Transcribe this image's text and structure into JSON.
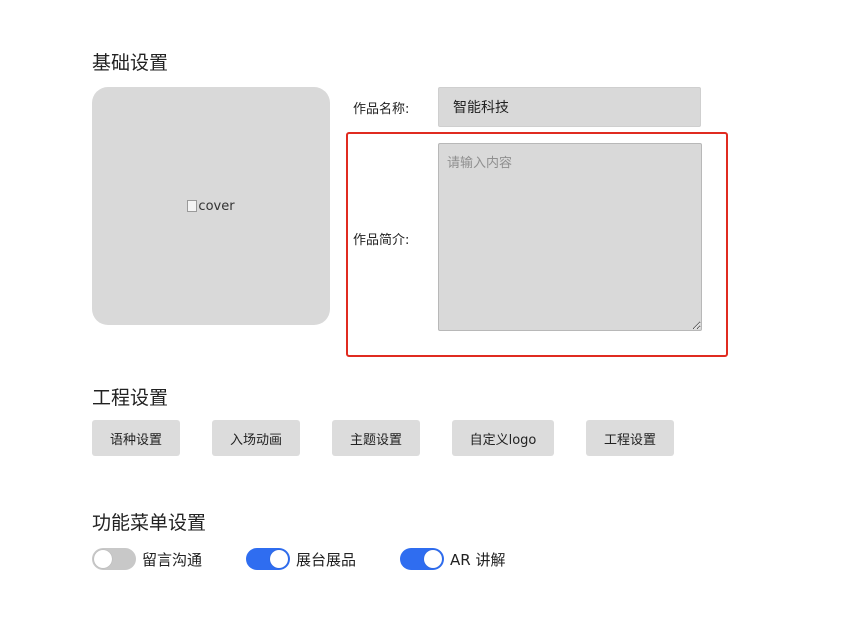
{
  "sections": {
    "basic": "基础设置",
    "project": "工程设置",
    "menu": "功能菜单设置"
  },
  "basic": {
    "cover_alt": "cover",
    "name_label": "作品名称:",
    "name_value": "智能科技",
    "intro_label": "作品简介:",
    "intro_placeholder": "请输入内容",
    "intro_value": ""
  },
  "project_buttons": [
    {
      "label": "语种设置"
    },
    {
      "label": "入场动画"
    },
    {
      "label": "主题设置"
    },
    {
      "label": "自定义logo"
    },
    {
      "label": "工程设置"
    }
  ],
  "menu_toggles": [
    {
      "label": "留言沟通",
      "on": false
    },
    {
      "label": "展台展品",
      "on": true
    },
    {
      "label": "AR 讲解",
      "on": true
    }
  ],
  "colors": {
    "accent": "#2f6df0",
    "highlight": "#e02b20",
    "field_bg": "#d9d9d9",
    "toggle_off": "#c8c8c8"
  }
}
